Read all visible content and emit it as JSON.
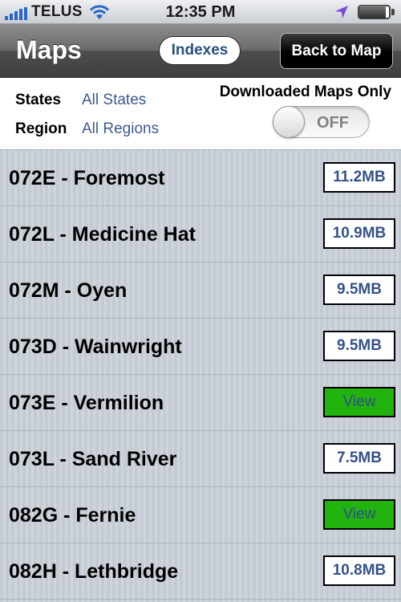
{
  "status_bar": {
    "carrier": "TELUS",
    "time": "12:35 PM",
    "battery_level": 0.95,
    "signal_color": "#2a66c9"
  },
  "nav": {
    "title": "Maps",
    "indexes_label": "Indexes",
    "back_label": "Back to Map"
  },
  "filters": {
    "states_label": "States",
    "states_value": "All States",
    "region_label": "Region",
    "region_value": "All Regions",
    "downloaded_label": "Downloaded Maps Only",
    "toggle_state": "OFF"
  },
  "colors": {
    "view_button": "#22b30e",
    "link_blue": "#3c5a91"
  },
  "maps": [
    {
      "name": "072E - Foremost",
      "action": "11.2MB",
      "type": "size"
    },
    {
      "name": "072L - Medicine Hat",
      "action": "10.9MB",
      "type": "size"
    },
    {
      "name": "072M - Oyen",
      "action": "9.5MB",
      "type": "size"
    },
    {
      "name": "073D - Wainwright",
      "action": "9.5MB",
      "type": "size"
    },
    {
      "name": "073E - Vermilion",
      "action": "View",
      "type": "view"
    },
    {
      "name": "073L - Sand River",
      "action": "7.5MB",
      "type": "size"
    },
    {
      "name": "082G - Fernie",
      "action": "View",
      "type": "view"
    },
    {
      "name": "082H - Lethbridge",
      "action": "10.8MB",
      "type": "size"
    }
  ]
}
